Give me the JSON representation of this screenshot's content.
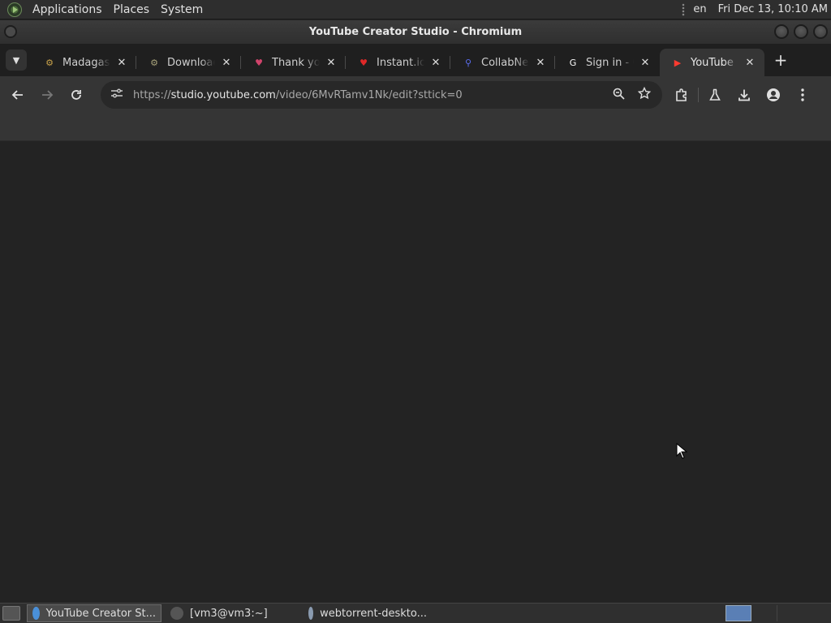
{
  "top_panel": {
    "menus": [
      "Applications",
      "Places",
      "System"
    ],
    "lang": "en",
    "clock": "Fri Dec 13, 10:10 AM"
  },
  "window": {
    "title": "YouTube Creator Studio - Chromium"
  },
  "tabs": [
    {
      "title": "Madagascar",
      "fav": "⚙",
      "fav_color": "#c8a24a",
      "active": false
    },
    {
      "title": "Download",
      "fav": "⚙",
      "fav_color": "#a7a27a",
      "active": false
    },
    {
      "title": "Thank you",
      "fav": "♥",
      "fav_color": "#d0436b",
      "active": false
    },
    {
      "title": "Instant.io",
      "fav": "♥",
      "fav_color": "#e02828",
      "active": false
    },
    {
      "title": "CollabNet",
      "fav": "⚲",
      "fav_color": "#5b6ef0",
      "active": false
    },
    {
      "title": "Sign in - G",
      "fav": "G",
      "fav_color": "#ffffff",
      "active": false
    },
    {
      "title": "YouTube",
      "fav": "▶",
      "fav_color": "#ff3b30",
      "active": true
    }
  ],
  "close_glyph": "✕",
  "new_tab_glyph": "+",
  "address": {
    "scheme": "https://",
    "host": "studio.youtube.com",
    "path": "/video/6MvRTamv1Nk/edit?sttick=0"
  },
  "taskbar": [
    {
      "label": "YouTube Creator St...",
      "icon_color": "#4a90d9",
      "active": true
    },
    {
      "label": "[vm3@vm3:~]",
      "icon_color": "#555",
      "active": false
    },
    {
      "label": "webtorrent-deskto...",
      "icon_color": "#8a9bb0",
      "active": false
    }
  ]
}
